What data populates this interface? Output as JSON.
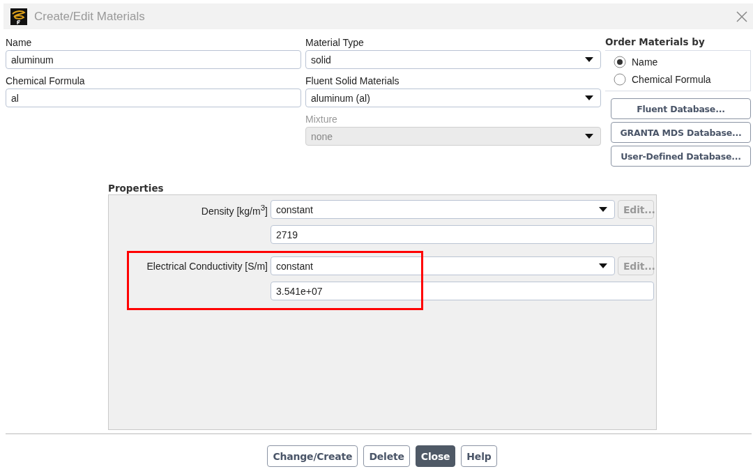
{
  "window": {
    "title": "Create/Edit Materials"
  },
  "name": {
    "label": "Name",
    "value": "aluminum"
  },
  "chemical_formula": {
    "label": "Chemical Formula",
    "value": "al"
  },
  "material_type": {
    "label": "Material Type",
    "value": "solid",
    "disabled": false
  },
  "fluent_solid_materials": {
    "label": "Fluent Solid Materials",
    "value": "aluminum (al)",
    "disabled": false
  },
  "mixture": {
    "label": "Mixture",
    "value": "none",
    "disabled": true
  },
  "order_materials_by": {
    "title": "Order Materials by",
    "options": [
      {
        "label": "Name",
        "selected": true
      },
      {
        "label": "Chemical Formula",
        "selected": false
      }
    ]
  },
  "database_buttons": [
    "Fluent Database...",
    "GRANTA MDS Database...",
    "User-Defined Database..."
  ],
  "properties": {
    "title": "Properties",
    "rows": [
      {
        "label": "Density [kg/m$^{3}$]",
        "method": "constant",
        "edit": "Edit...",
        "edit_disabled": true,
        "value": "2719",
        "highlighted": false
      },
      {
        "label": "Electrical Conductivity [S/m]",
        "method": "constant",
        "edit": "Edit...",
        "edit_disabled": true,
        "value": "3.541e+07",
        "highlighted": true
      }
    ]
  },
  "footer_buttons": [
    {
      "label": "Change/Create",
      "kind": "normal"
    },
    {
      "label": "Delete",
      "kind": "normal"
    },
    {
      "label": "Close",
      "kind": "primary"
    },
    {
      "label": "Help",
      "kind": "normal"
    }
  ]
}
